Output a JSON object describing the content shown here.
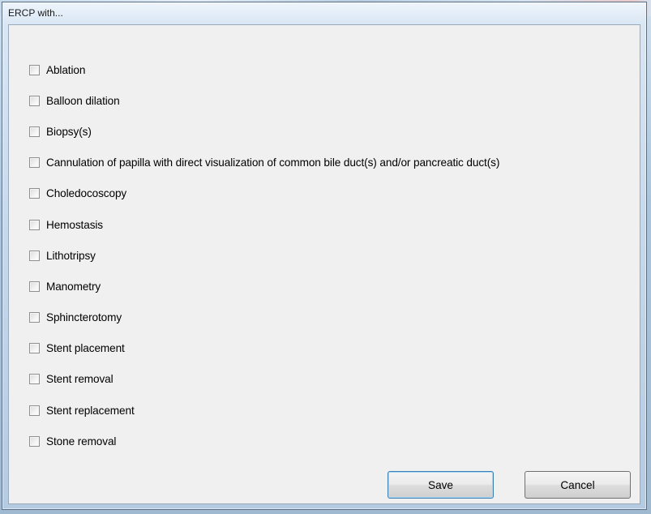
{
  "dialog": {
    "title": "ERCP with..."
  },
  "checklist": {
    "items": [
      {
        "label": "Ablation",
        "checked": false
      },
      {
        "label": "Balloon dilation",
        "checked": false
      },
      {
        "label": "Biopsy(s)",
        "checked": false
      },
      {
        "label": "Cannulation of papilla with direct visualization of common bile duct(s) and/or pancreatic duct(s)",
        "checked": false
      },
      {
        "label": "Choledocoscopy",
        "checked": false
      },
      {
        "label": "Hemostasis",
        "checked": false
      },
      {
        "label": "Lithotripsy",
        "checked": false
      },
      {
        "label": "Manometry",
        "checked": false
      },
      {
        "label": "Sphincterotomy",
        "checked": false
      },
      {
        "label": "Stent placement",
        "checked": false
      },
      {
        "label": "Stent removal",
        "checked": false
      },
      {
        "label": "Stent replacement",
        "checked": false
      },
      {
        "label": "Stone removal",
        "checked": false
      }
    ]
  },
  "buttons": {
    "save_label": "Save",
    "cancel_label": "Cancel"
  }
}
